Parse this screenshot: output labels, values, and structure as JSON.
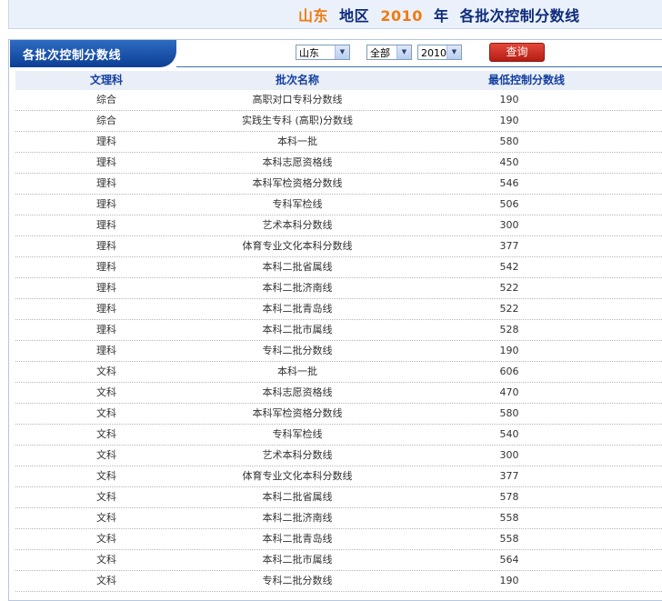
{
  "header": {
    "region": "山东",
    "region_suffix": "地区",
    "year": "2010",
    "year_suffix": "年",
    "title_tail": "各批次控制分数线"
  },
  "tab": {
    "label": "各批次控制分数线"
  },
  "filters": {
    "province": "山东",
    "category": "全部",
    "year": "2010",
    "query_label": "查询"
  },
  "table": {
    "headers": [
      "文理科",
      "批次名称",
      "最低控制分数线"
    ],
    "rows": [
      [
        "综合",
        "高职对口专科分数线",
        "190"
      ],
      [
        "综合",
        "实践生专科 (高职)分数线",
        "190"
      ],
      [
        "理科",
        "本科一批",
        "580"
      ],
      [
        "理科",
        "本科志愿资格线",
        "450"
      ],
      [
        "理科",
        "本科军检资格分数线",
        "546"
      ],
      [
        "理科",
        "专科军检线",
        "506"
      ],
      [
        "理科",
        "艺术本科分数线",
        "300"
      ],
      [
        "理科",
        "体育专业文化本科分数线",
        "377"
      ],
      [
        "理科",
        "本科二批省属线",
        "542"
      ],
      [
        "理科",
        "本科二批济南线",
        "522"
      ],
      [
        "理科",
        "本科二批青岛线",
        "522"
      ],
      [
        "理科",
        "本科二批市属线",
        "528"
      ],
      [
        "理科",
        "专科二批分数线",
        "190"
      ],
      [
        "文科",
        "本科一批",
        "606"
      ],
      [
        "文科",
        "本科志愿资格线",
        "470"
      ],
      [
        "文科",
        "本科军检资格分数线",
        "580"
      ],
      [
        "文科",
        "专科军检线",
        "540"
      ],
      [
        "文科",
        "艺术本科分数线",
        "300"
      ],
      [
        "文科",
        "体育专业文化本科分数线",
        "377"
      ],
      [
        "文科",
        "本科二批省属线",
        "578"
      ],
      [
        "文科",
        "本科二批济南线",
        "558"
      ],
      [
        "文科",
        "本科二批青岛线",
        "558"
      ],
      [
        "文科",
        "本科二批市属线",
        "564"
      ],
      [
        "文科",
        "专科二批分数线",
        "190"
      ]
    ]
  }
}
